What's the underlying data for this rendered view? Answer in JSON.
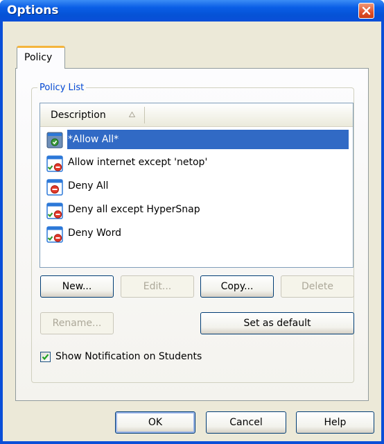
{
  "window": {
    "title": "Options"
  },
  "tabs": [
    {
      "label": "Policy"
    }
  ],
  "policy_list": {
    "group_label": "Policy List",
    "column_header": "Description",
    "items": [
      {
        "label": "*Allow All*",
        "icon": "allow-policy-icon",
        "selected": true
      },
      {
        "label": "Allow internet except 'netop'",
        "icon": "mixed-policy-icon",
        "selected": false
      },
      {
        "label": "Deny All",
        "icon": "deny-policy-icon",
        "selected": false
      },
      {
        "label": "Deny all except HyperSnap",
        "icon": "mixed-policy-icon",
        "selected": false
      },
      {
        "label": "Deny Word",
        "icon": "mixed-policy-icon",
        "selected": false
      }
    ]
  },
  "buttons": {
    "new": "New...",
    "edit": "Edit...",
    "copy": "Copy...",
    "delete": "Delete",
    "rename": "Rename...",
    "set_default": "Set as default"
  },
  "show_notification": {
    "label": "Show Notification on Students",
    "checked": true
  },
  "footer": {
    "ok": "OK",
    "cancel": "Cancel",
    "help": "Help"
  },
  "colors": {
    "title_bar": "#0a5ee6",
    "selection": "#316ac5",
    "group_label": "#0046d5",
    "dialog_bg": "#ece9d8"
  }
}
